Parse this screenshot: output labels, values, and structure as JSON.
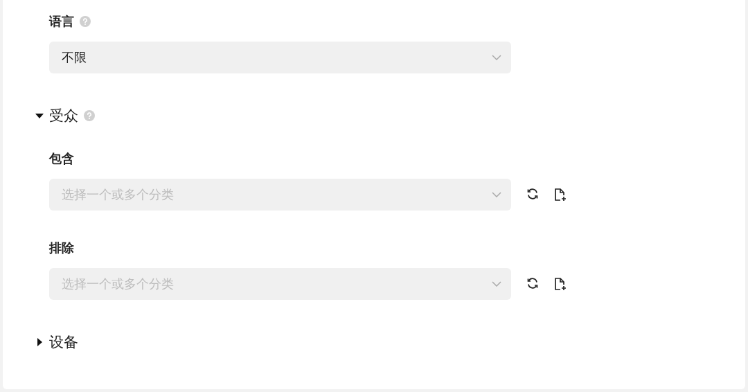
{
  "items": [
    {
      "kind": "field",
      "label": "语言",
      "help": true,
      "select": {
        "value": "不限"
      }
    },
    {
      "kind": "section",
      "title": "受众",
      "help": true,
      "expanded": true,
      "children": [
        {
          "kind": "field",
          "label": "包含",
          "help": false,
          "select": {
            "placeholder": "选择一个或多个分类"
          },
          "actions": true
        },
        {
          "kind": "field",
          "label": "排除",
          "help": false,
          "select": {
            "placeholder": "选择一个或多个分类"
          },
          "actions": true
        }
      ]
    },
    {
      "kind": "section",
      "title": "设备",
      "help": false,
      "expanded": false
    }
  ]
}
